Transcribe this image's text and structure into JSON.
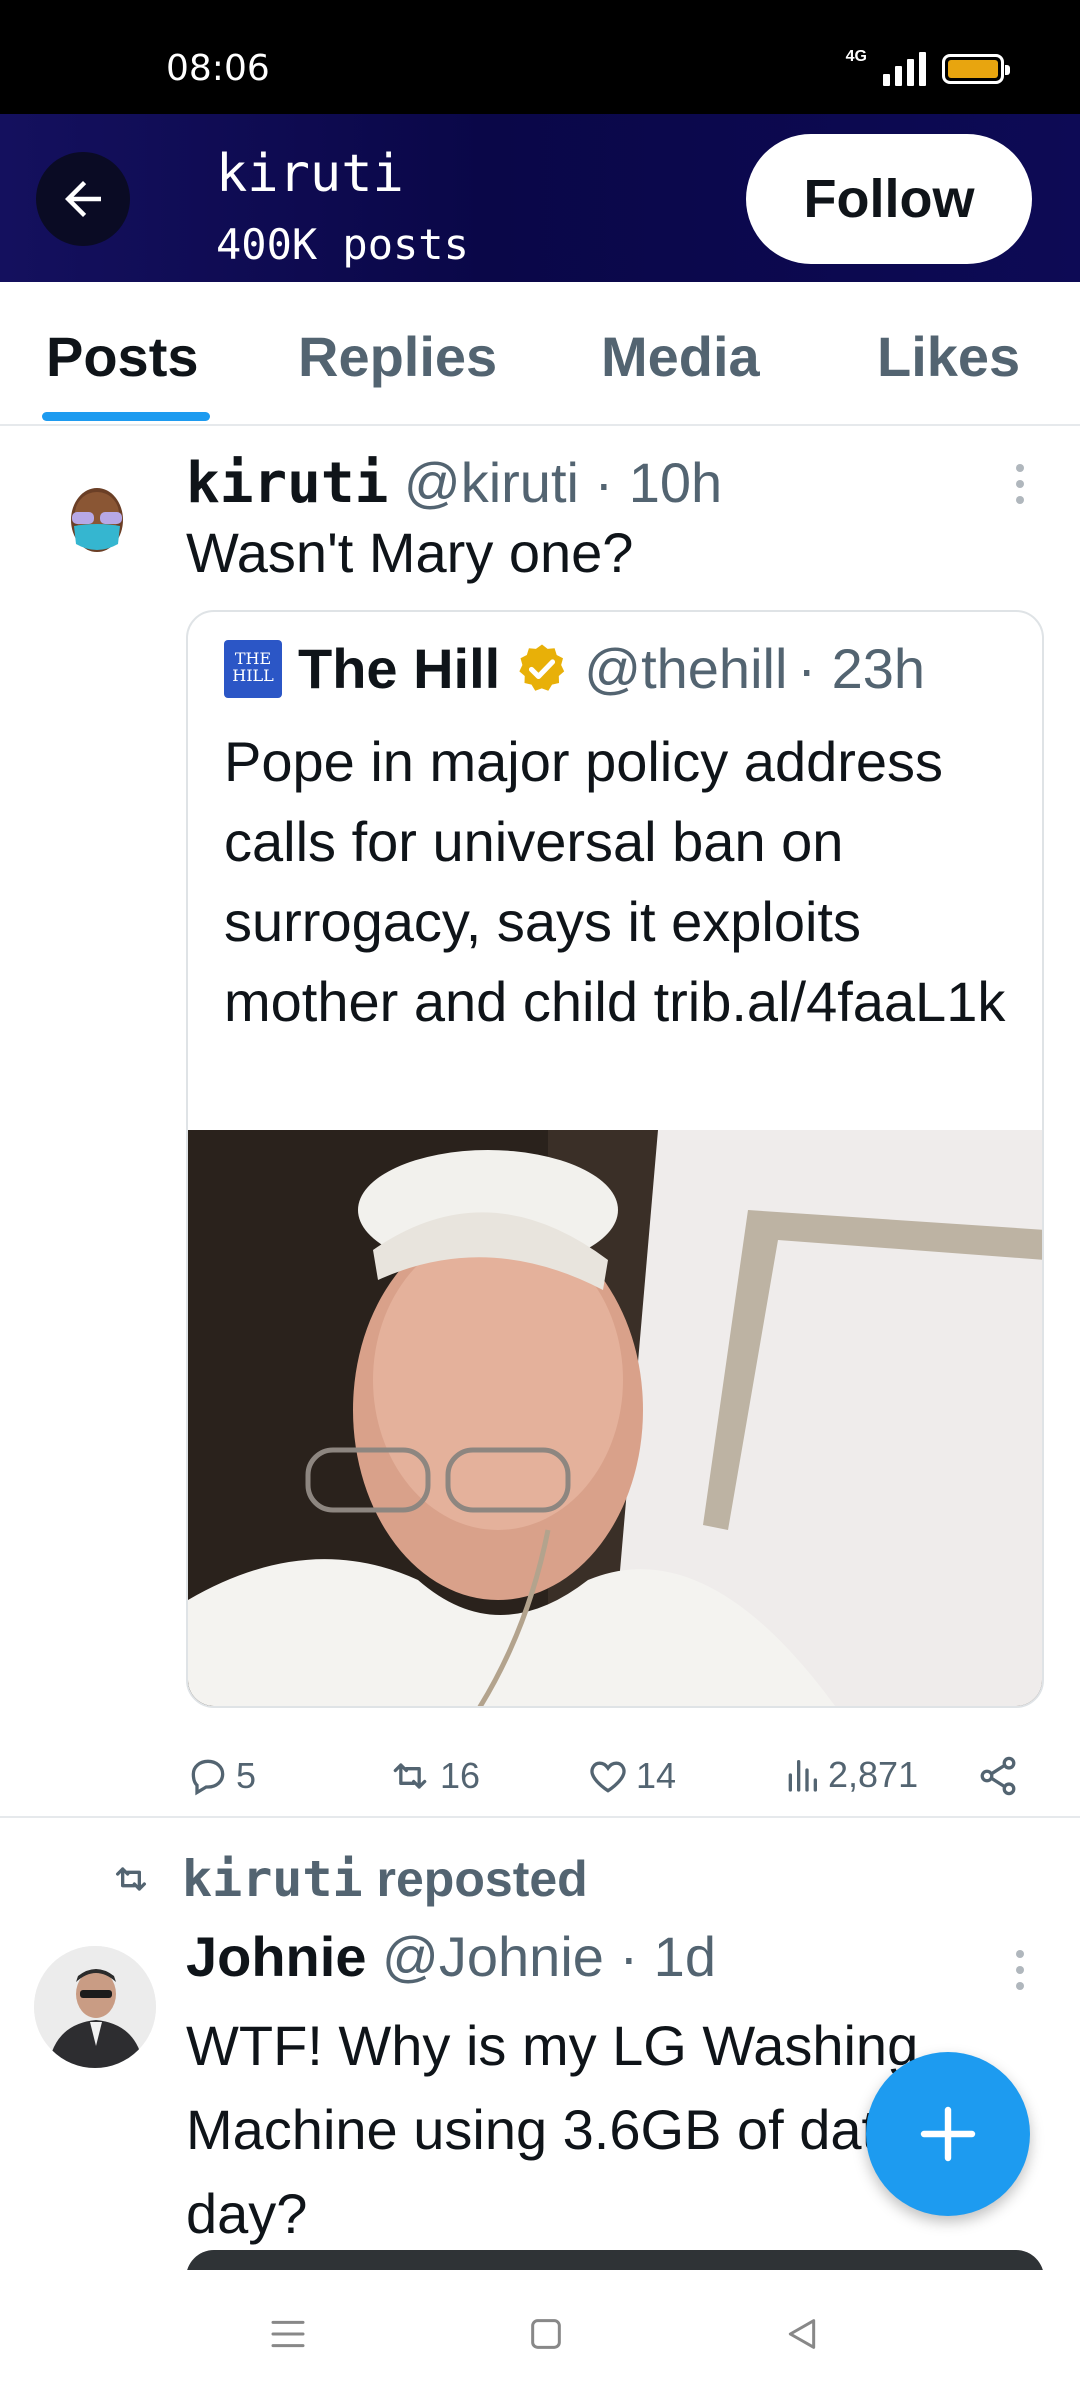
{
  "status_bar": {
    "time": "08:06",
    "network": "4G"
  },
  "header": {
    "name": "kiruti",
    "post_count": "400K posts",
    "follow_label": "Follow"
  },
  "tabs": [
    {
      "label": "Posts",
      "active": true
    },
    {
      "label": "Replies",
      "active": false
    },
    {
      "label": "Media",
      "active": false
    },
    {
      "label": "Likes",
      "active": false
    }
  ],
  "post": {
    "author": "kiruti",
    "handle": "@kiruti",
    "time": "· 10h",
    "text": "Wasn't Mary one?",
    "quote": {
      "author": "The Hill",
      "handle": "@thehill",
      "time": "· 23h",
      "text": "Pope in major policy address calls for universal ban on surrogacy, says it exploits mother and child trib.al/4faaL1k",
      "verified": true
    },
    "stats": {
      "replies": "5",
      "reposts": "16",
      "likes": "14",
      "views": "2,871"
    }
  },
  "post2": {
    "repost_by": "kiruti",
    "repost_label": "reposted",
    "author": "Johnie",
    "handle": "@Johnie",
    "time": "· 1d",
    "text": "WTF!  Why is my LG Washing Machine using 3.6GB of data a day?"
  },
  "colors": {
    "accent": "#1d9bf0",
    "header_bg": "#0a0748",
    "verified": "#e8b008",
    "muted": "#536471"
  }
}
